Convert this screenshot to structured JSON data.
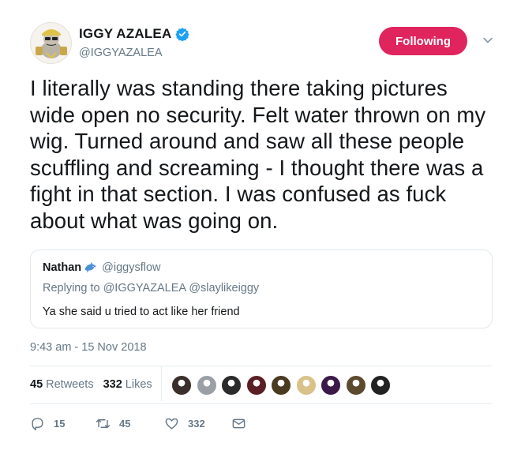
{
  "author": {
    "display_name": "IGGY AZALEA",
    "handle": "@IGGYAZALEA",
    "verified_icon": "verified-badge-icon",
    "avatar_icon": "cartoon-mascot-avatar"
  },
  "follow_button": {
    "label": "Following",
    "color": "#e0245e"
  },
  "tweet": {
    "text": "I literally was standing there taking pictures wide open no security. Felt water thrown on my wig. Turned around and saw all these people scuffling and screaming - I thought there was a fight in that section. I was confused as fuck about what was going on."
  },
  "quoted_tweet": {
    "name": "Nathan",
    "emoji_icon": "dolphin-icon",
    "handle": "@iggysflow",
    "replying_prefix": "Replying to",
    "replying_to": "@IGGYAZALEA @slaylikeiggy",
    "text": "Ya she said u tried to act like her friend"
  },
  "timestamp": "9:43 am - 15 Nov 2018",
  "stats": {
    "retweets_count": "45",
    "retweets_label": "Retweets",
    "likes_count": "332",
    "likes_label": "Likes"
  },
  "likers_colors": [
    "#3a2f2a",
    "#9aa0a6",
    "#2b2b2b",
    "#5a1f24",
    "#4a3b20",
    "#d9c28a",
    "#3b1a4a",
    "#5c4a2e",
    "#222222"
  ],
  "actions": {
    "reply_count": "15",
    "retweet_count": "45",
    "like_count": "332"
  },
  "colors": {
    "text": "#14171a",
    "secondary": "#657786",
    "border": "#e1e8ed",
    "verified": "#1da1f2"
  }
}
